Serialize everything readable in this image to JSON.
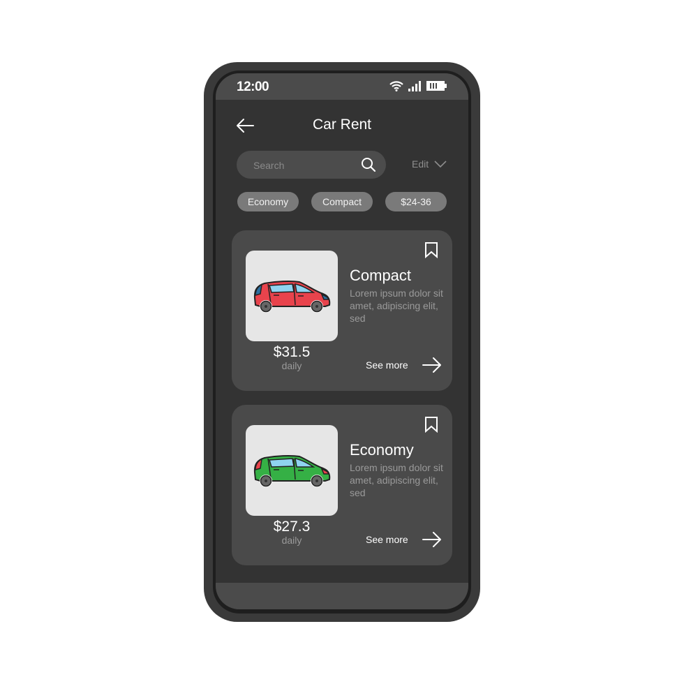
{
  "status_bar": {
    "time": "12:00",
    "icons": [
      "wifi-icon",
      "signal-icon",
      "battery-icon"
    ]
  },
  "header": {
    "title": "Car Rent",
    "back_icon": "arrow-left-icon"
  },
  "search": {
    "placeholder": "Search",
    "value": "",
    "icon": "search-icon"
  },
  "edit": {
    "label": "Edit",
    "icon": "chevron-down-icon"
  },
  "filters": [
    {
      "label": "Economy"
    },
    {
      "label": "Compact"
    },
    {
      "label": "$24-36"
    }
  ],
  "cars": [
    {
      "title": "Compact",
      "description": "Lorem ipsum dolor sit amet, adipiscing elit, sed",
      "price": "$31.5",
      "period": "daily",
      "see_more": "See more",
      "body_color": "#e8434c",
      "light_color": "#2d6fa0"
    },
    {
      "title": "Economy",
      "description": "Lorem ipsum dolor sit amet, adipiscing elit, sed",
      "price": "$27.3",
      "period": "daily",
      "see_more": "See more",
      "body_color": "#35b045",
      "light_color": "#e8434c"
    }
  ],
  "colors": {
    "screen_bg": "#333333",
    "card_bg": "#4a4a4a",
    "chip_bg": "#7a7a7a",
    "window_glass": "#8fd4f0"
  }
}
